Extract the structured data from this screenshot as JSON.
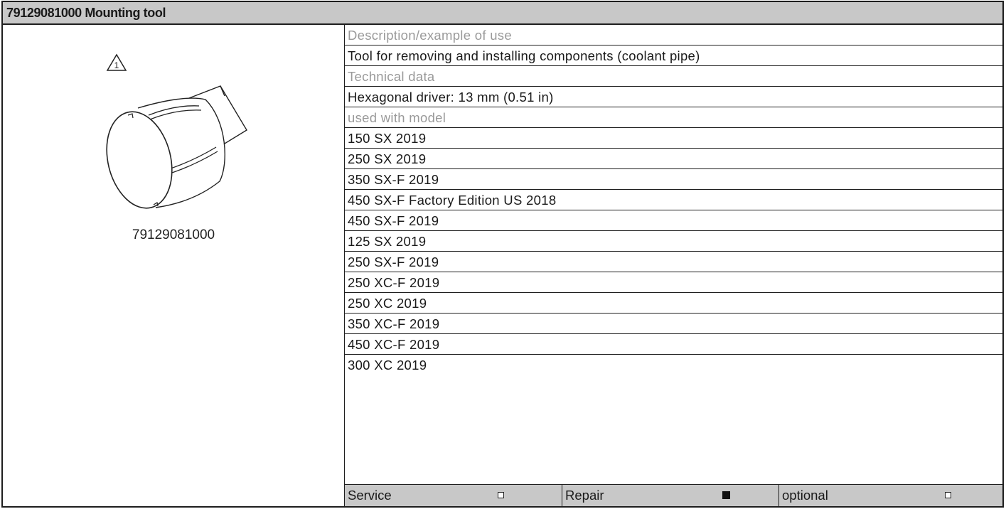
{
  "header": {
    "title": "79129081000 Mounting tool"
  },
  "figure": {
    "callout_number": "1",
    "part_number": "79129081000"
  },
  "details": {
    "description_label": "Description/example of use",
    "description": "Tool for removing and installing components (coolant pipe)",
    "technical_label": "Technical data",
    "technical": "Hexagonal driver: 13 mm (0.51 in)",
    "models_label": "used with model",
    "models": [
      "150 SX 2019",
      "250 SX 2019",
      "350 SX-F 2019",
      "450 SX-F Factory Edition US 2018",
      "450 SX-F 2019",
      "125 SX 2019",
      "250 SX-F 2019",
      "250 XC-F 2019",
      "250 XC 2019",
      "350 XC-F 2019",
      "450 XC-F 2019",
      "300 XC 2019"
    ]
  },
  "footer": {
    "service_label": "Service",
    "service_checked": false,
    "repair_label": "Repair",
    "repair_checked": true,
    "optional_label": "optional",
    "optional_checked": false
  }
}
